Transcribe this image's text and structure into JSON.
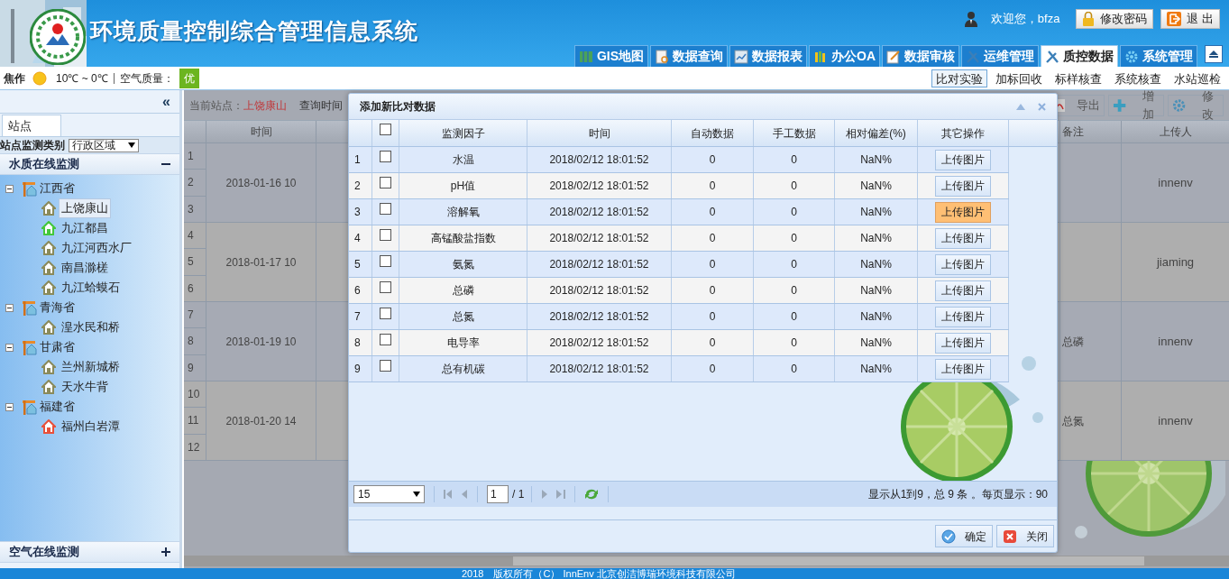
{
  "header": {
    "title": "环境质量控制综合管理信息系统",
    "greeting": "欢迎您，bfza",
    "buttons": [
      {
        "label": "修改密码",
        "kind": "lock"
      },
      {
        "label": "退 出",
        "kind": "exit"
      }
    ],
    "nav_tabs": [
      {
        "label": "GIS地图",
        "selected": false
      },
      {
        "label": "数据查询",
        "selected": false
      },
      {
        "label": "数据报表",
        "selected": false
      },
      {
        "label": "办公OA",
        "selected": false
      },
      {
        "label": "数据审核",
        "selected": false
      },
      {
        "label": "运维管理",
        "selected": false
      },
      {
        "label": "质控数据",
        "selected": true
      },
      {
        "label": "系统管理",
        "selected": false
      }
    ]
  },
  "info_bar": {
    "city": "焦作",
    "temperature": "10℃ ~ 0℃",
    "air_label": "空气质量：",
    "air_value": "优",
    "sub_tabs": [
      {
        "label": "比对实验",
        "selected": true
      },
      {
        "label": "加标回收",
        "selected": false
      },
      {
        "label": "标样核查",
        "selected": false
      },
      {
        "label": "系统核查",
        "selected": false
      },
      {
        "label": "水站巡检",
        "selected": false
      }
    ]
  },
  "sidebar": {
    "collapse": "«",
    "tab": "站点",
    "filter_label": "站点监测类别",
    "filter_value": "行政区域",
    "sections": [
      {
        "title": "水质在线监测",
        "expanded": true,
        "tree": [
          {
            "label": "江西省",
            "expanded": true,
            "children": [
              {
                "label": "上饶康山",
                "selected": true,
                "color": "#8a8a5a"
              },
              {
                "label": "九江都昌",
                "selected": false,
                "color": "#44c73a"
              },
              {
                "label": "九江河西水厂",
                "selected": false,
                "color": "#8a8a5a"
              },
              {
                "label": "南昌滁槎",
                "selected": false,
                "color": "#8a8a5a"
              },
              {
                "label": "九江蛤蟆石",
                "selected": false,
                "color": "#8a8a5a"
              }
            ]
          },
          {
            "label": "青海省",
            "expanded": true,
            "children": [
              {
                "label": "湟水民和桥",
                "selected": false,
                "color": "#8a8a5a"
              }
            ]
          },
          {
            "label": "甘肃省",
            "expanded": true,
            "children": [
              {
                "label": "兰州新城桥",
                "selected": false,
                "color": "#8a8a5a"
              },
              {
                "label": "天水牛背",
                "selected": false,
                "color": "#8a8a5a"
              }
            ]
          },
          {
            "label": "福建省",
            "expanded": true,
            "children": [
              {
                "label": "福州白岩潭",
                "selected": false,
                "color": "#e8503a"
              }
            ]
          }
        ]
      },
      {
        "title": "空气在线监测",
        "expanded": false
      }
    ]
  },
  "main": {
    "station_label": "当前站点：",
    "station": "上饶康山",
    "query_label": "查询时间",
    "toolbar": [
      {
        "label": "导出",
        "kind": "pdf"
      },
      {
        "label": "增加",
        "kind": "plus"
      },
      {
        "label": "修改",
        "kind": "gear"
      }
    ],
    "columns": {
      "time": "时间",
      "remark": "备注",
      "uploader": "上传人"
    },
    "groups": [
      {
        "row_numbers": [
          "1",
          "2",
          "3"
        ],
        "time": "2018-01-16 10",
        "uploader": "innenv"
      },
      {
        "row_numbers": [
          "4",
          "5",
          "6"
        ],
        "time": "2018-01-17 10",
        "uploader": "jiaming"
      },
      {
        "row_numbers": [
          "7",
          "8",
          "9"
        ],
        "time": "2018-01-19 10",
        "remark": "总磷",
        "uploader": "innenv"
      },
      {
        "row_numbers": [
          "10",
          "11",
          "12"
        ],
        "time": "2018-01-20 14",
        "remark": "总氮",
        "uploader": "innenv"
      }
    ]
  },
  "dialog": {
    "title": "添加新比对数据",
    "all_checked": false,
    "columns": [
      "监测因子",
      "时间",
      "自动数据",
      "手工数据",
      "相对偏差(%)",
      "其它操作"
    ],
    "rows": [
      {
        "index": "1",
        "checked": false,
        "factor": "水温",
        "time": "2018/02/12 18:01:52",
        "auto": "0",
        "manual": "0",
        "deviation": "NaN%",
        "action": "上传图片",
        "hovered": false
      },
      {
        "index": "2",
        "checked": false,
        "factor": "pH值",
        "time": "2018/02/12 18:01:52",
        "auto": "0",
        "manual": "0",
        "deviation": "NaN%",
        "action": "上传图片",
        "hovered": false
      },
      {
        "index": "3",
        "checked": false,
        "factor": "溶解氧",
        "time": "2018/02/12 18:01:52",
        "auto": "0",
        "manual": "0",
        "deviation": "NaN%",
        "action": "上传图片",
        "hovered": true
      },
      {
        "index": "4",
        "checked": false,
        "factor": "高锰酸盐指数",
        "time": "2018/02/12 18:01:52",
        "auto": "0",
        "manual": "0",
        "deviation": "NaN%",
        "action": "上传图片",
        "hovered": false
      },
      {
        "index": "5",
        "checked": false,
        "factor": "氨氮",
        "time": "2018/02/12 18:01:52",
        "auto": "0",
        "manual": "0",
        "deviation": "NaN%",
        "action": "上传图片",
        "hovered": false
      },
      {
        "index": "6",
        "checked": false,
        "factor": "总磷",
        "time": "2018/02/12 18:01:52",
        "auto": "0",
        "manual": "0",
        "deviation": "NaN%",
        "action": "上传图片",
        "hovered": false
      },
      {
        "index": "7",
        "checked": false,
        "factor": "总氮",
        "time": "2018/02/12 18:01:52",
        "auto": "0",
        "manual": "0",
        "deviation": "NaN%",
        "action": "上传图片",
        "hovered": false
      },
      {
        "index": "8",
        "checked": false,
        "factor": "电导率",
        "time": "2018/02/12 18:01:52",
        "auto": "0",
        "manual": "0",
        "deviation": "NaN%",
        "action": "上传图片",
        "hovered": false
      },
      {
        "index": "9",
        "checked": false,
        "factor": "总有机碳",
        "time": "2018/02/12 18:01:52",
        "auto": "0",
        "manual": "0",
        "deviation": "NaN%",
        "action": "上传图片",
        "hovered": false
      }
    ],
    "pager": {
      "page_size": "15",
      "page": "1",
      "total_pages": "/ 1",
      "info": "显示从1到9，总 9 条 。每页显示：90"
    },
    "buttons": [
      {
        "label": "确定",
        "kind": "ok"
      },
      {
        "label": "关闭",
        "kind": "close"
      }
    ]
  },
  "footer": "2018　版权所有（C） InnEnv 北京创洁博瑞环境科技有限公司"
}
